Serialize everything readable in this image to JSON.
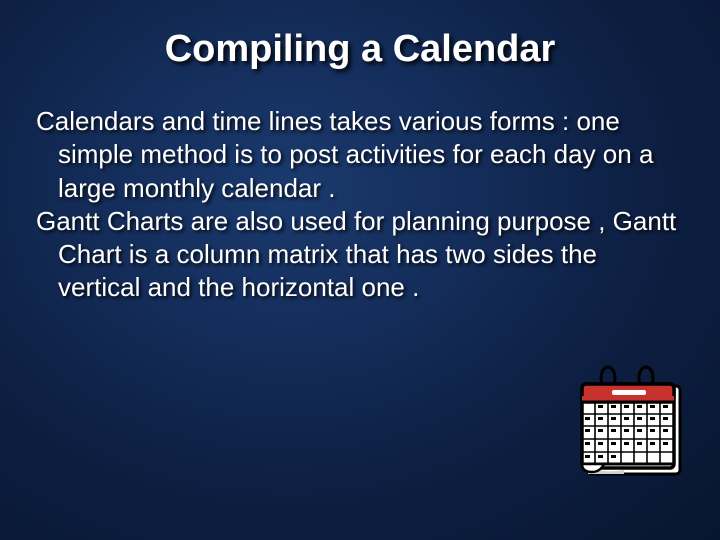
{
  "title": "Compiling a Calendar",
  "paragraph1": "Calendars and time lines takes various forms : one simple method is to post activities for each day on a large monthly calendar .",
  "paragraph2": "Gantt Charts are also used for planning purpose , Gantt Chart is a column matrix that has two sides the vertical and the horizontal one .",
  "illustration": "calendar-icon"
}
